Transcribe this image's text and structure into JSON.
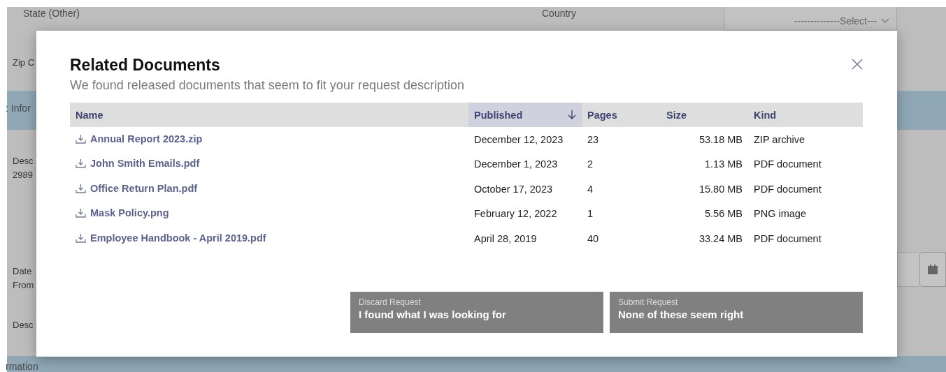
{
  "page": {
    "state_label": "State (Other)",
    "country_label": "Country",
    "country_select": {
      "value": "--------------Select---"
    },
    "zip_label": "Zip C",
    "section_1": ": Infor",
    "description_label": "Desc",
    "description_value": "2989",
    "date_label": "Date",
    "date_sublabel": "From",
    "description_label_2": "Desc",
    "section_2": "rmation"
  },
  "modal": {
    "title": "Related Documents",
    "subtitle": "We found released documents that seem to fit your request description",
    "columns": [
      {
        "label": "Name",
        "sorted": false
      },
      {
        "label": "Published",
        "sorted": true
      },
      {
        "label": "Pages",
        "sorted": false
      },
      {
        "label": "Size",
        "sorted": false
      },
      {
        "label": "Kind",
        "sorted": false
      }
    ],
    "rows": [
      {
        "name": "Annual Report 2023.zip",
        "published": "December 12, 2023",
        "pages": "23",
        "size": "53.18 MB",
        "kind": "ZIP archive"
      },
      {
        "name": "John Smith Emails.pdf",
        "published": "December 1, 2023",
        "pages": "2",
        "size": "1.13 MB",
        "kind": "PDF document"
      },
      {
        "name": "Office Return Plan.pdf",
        "published": "October 17, 2023",
        "pages": "4",
        "size": "15.80 MB",
        "kind": "PDF document"
      },
      {
        "name": "Mask Policy.png",
        "published": "February 12, 2022",
        "pages": "1",
        "size": "5.56 MB",
        "kind": "PNG image"
      },
      {
        "name": "Employee Handbook - April 2019.pdf",
        "published": "April 28, 2019",
        "pages": "40",
        "size": "33.24 MB",
        "kind": "PDF document"
      }
    ],
    "buttons": [
      {
        "caption": "Discard Request",
        "label": "I found what I was looking for"
      },
      {
        "caption": "Submit Request",
        "label": "None of these seem right"
      }
    ]
  }
}
